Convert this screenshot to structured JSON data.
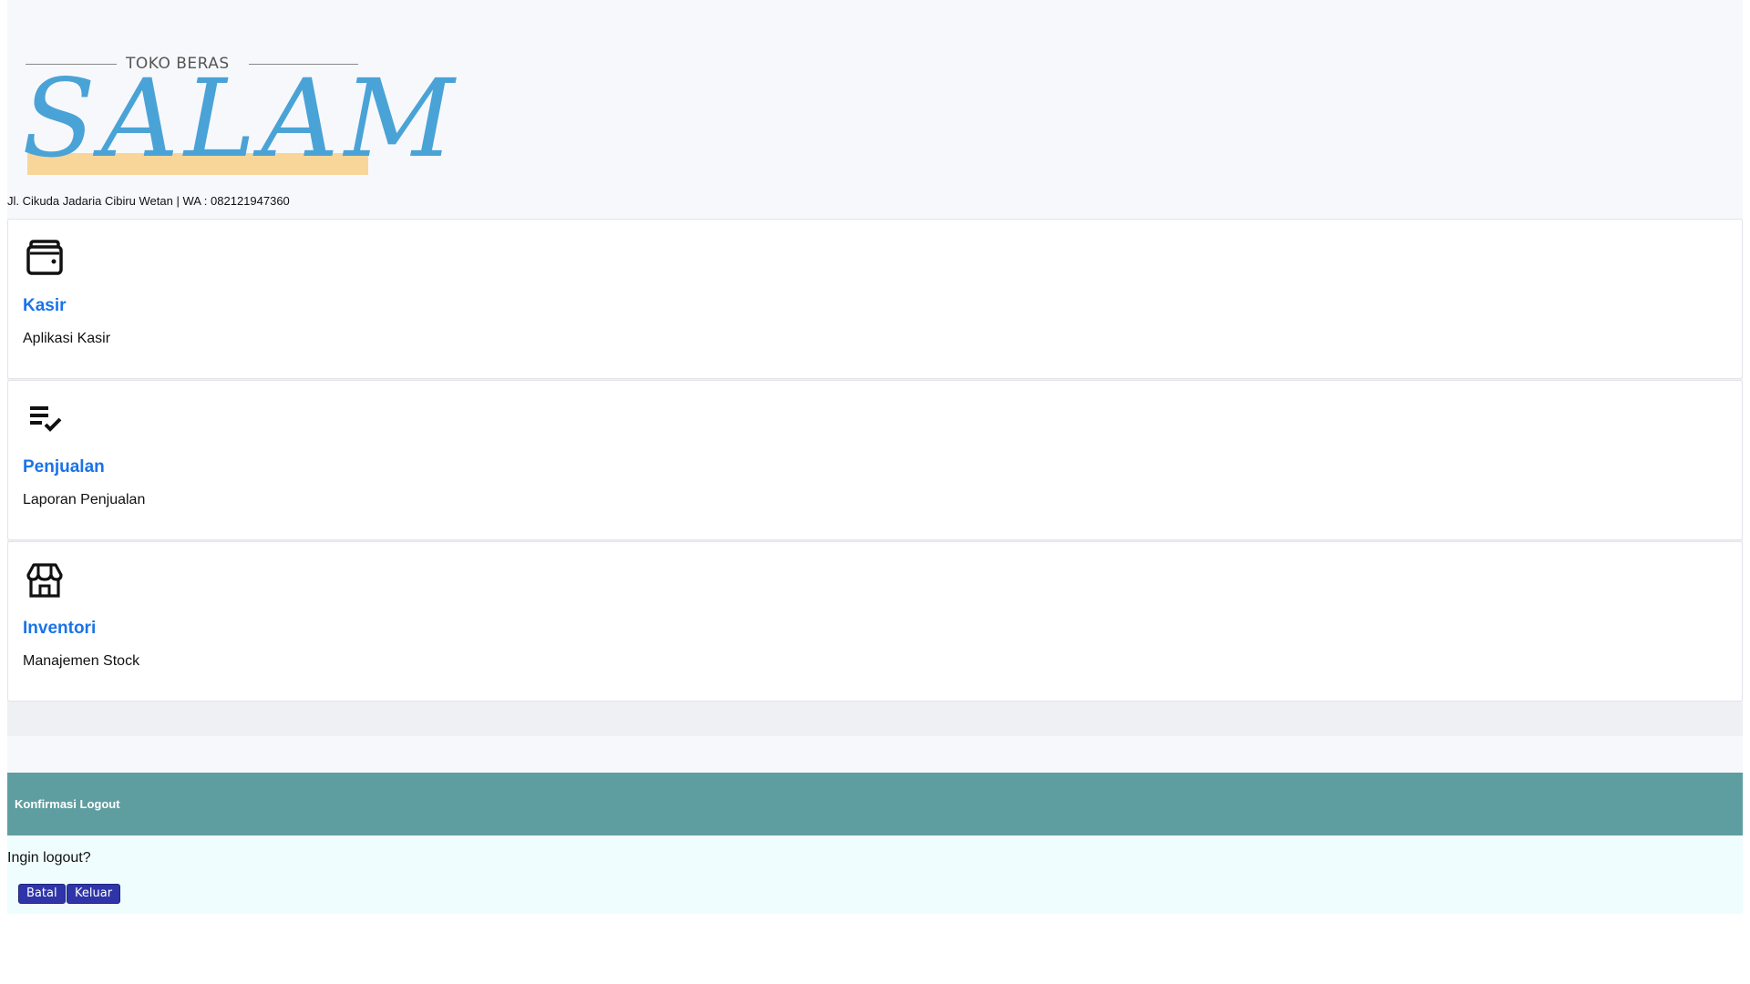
{
  "brand": {
    "subtitle": "TOKO BERAS",
    "name": "SALAM",
    "address": "Jl. Cikuda Jadaria Cibiru Wetan | WA : 082121947360",
    "colors": {
      "logo_blue": "#4aa3d6",
      "logo_highlight": "#f8d69a"
    }
  },
  "menu": {
    "items": [
      {
        "icon": "wallet-icon",
        "title": "Kasir",
        "description": "Aplikasi Kasir"
      },
      {
        "icon": "checklist-icon",
        "title": "Penjualan",
        "description": "Laporan Penjualan"
      },
      {
        "icon": "storefront-icon",
        "title": "Inventori",
        "description": "Manajemen Stock"
      }
    ],
    "colors": {
      "title": "#1a73e8"
    }
  },
  "logout_dialog": {
    "title": "Konfirmasi Logout",
    "question": "Ingin logout?",
    "cancel_label": "Batal",
    "confirm_label": "Keluar",
    "colors": {
      "header": "#5f9ea0",
      "body": "#f0fdfe",
      "button": "#2f35a8"
    }
  }
}
